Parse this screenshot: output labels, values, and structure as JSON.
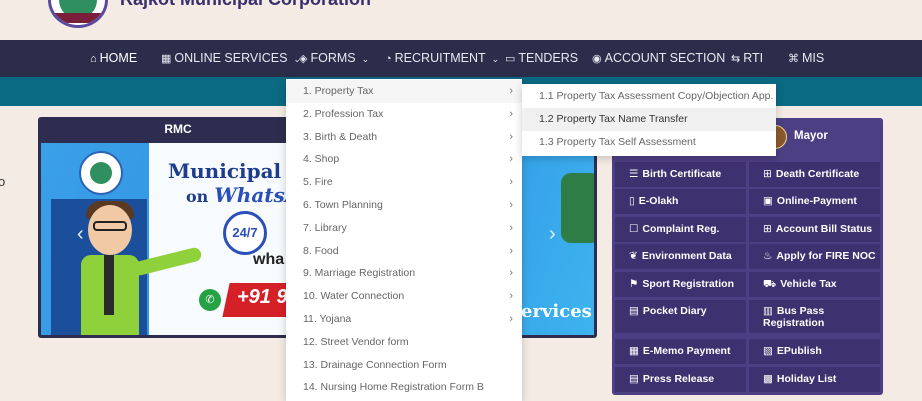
{
  "header": {
    "org_title": "Rajkot Municipal Corporation"
  },
  "nav": {
    "items": [
      {
        "label": "HOME",
        "icon": "home-icon",
        "glyph": "⌂",
        "caret": ""
      },
      {
        "label": "ONLINE SERVICES",
        "icon": "grid-icon",
        "glyph": "▦",
        "caret": "⌄"
      },
      {
        "label": "FORMS",
        "icon": "layers-icon",
        "glyph": "◈",
        "caret": "⌄"
      },
      {
        "label": "RECRUITMENT",
        "icon": "recruitment-icon",
        "glyph": "◔",
        "caret": "⌄"
      },
      {
        "label": "TENDERS",
        "icon": "calendar-icon",
        "glyph": "▭",
        "caret": ""
      },
      {
        "label": "ACCOUNT SECTION",
        "icon": "account-icon",
        "glyph": "◉",
        "caret": ""
      },
      {
        "label": "RTI",
        "icon": "rti-icon",
        "glyph": "⇆",
        "caret": ""
      },
      {
        "label": "MIS",
        "icon": "command-icon",
        "glyph": "⌘",
        "caret": ""
      }
    ]
  },
  "rmc": {
    "title": "RMC",
    "slide": {
      "headline": "Municipal Ser",
      "on": "on",
      "whatsapp": "WhatsA",
      "clock": "24/7",
      "wha": "wha",
      "phone": "+91 9",
      "services": "ervices",
      "prev": "‹",
      "next": "›"
    }
  },
  "forms_menu": {
    "items": [
      {
        "label": "1. Property Tax",
        "arrow": "›"
      },
      {
        "label": "2. Profession Tax",
        "arrow": "›"
      },
      {
        "label": "3. Birth & Death",
        "arrow": "›"
      },
      {
        "label": "4. Shop",
        "arrow": "›"
      },
      {
        "label": "5. Fire",
        "arrow": "›"
      },
      {
        "label": "6. Town Planning",
        "arrow": "›"
      },
      {
        "label": "7. Library",
        "arrow": "›"
      },
      {
        "label": "8. Food",
        "arrow": "›"
      },
      {
        "label": "9. Marriage Registration",
        "arrow": "›"
      },
      {
        "label": "10. Water Connection",
        "arrow": "›"
      },
      {
        "label": "11. Yojana",
        "arrow": "›"
      },
      {
        "label": "12. Street Vendor form",
        "arrow": ""
      },
      {
        "label": "13. Drainage Connection Form",
        "arrow": ""
      },
      {
        "label": "14. Nursing Home Registration Form B",
        "arrow": ""
      }
    ]
  },
  "property_tax_menu": {
    "items": [
      {
        "label": "1.1 Property Tax Assessment Copy/Objection App."
      },
      {
        "label": "1.2 Property Tax Name Transfer"
      },
      {
        "label": "1.3 Property Tax Self Assessment"
      }
    ]
  },
  "quick_links": {
    "mayor": "Mayor",
    "buttons": [
      {
        "label": "Birth Certificate",
        "icon": "list-icon",
        "glyph": "☰"
      },
      {
        "label": "Death Certificate",
        "icon": "grid-icon",
        "glyph": "⊞"
      },
      {
        "label": "E-Olakh",
        "icon": "card-icon",
        "glyph": "▯"
      },
      {
        "label": "Online-Payment",
        "icon": "payment-icon",
        "glyph": "▣"
      },
      {
        "label": "Complaint Reg.",
        "icon": "square-icon",
        "glyph": "☐"
      },
      {
        "label": "Account Bill Status",
        "icon": "grid-icon",
        "glyph": "⊞"
      },
      {
        "label": "Environment Data",
        "icon": "leaf-icon",
        "glyph": "❦"
      },
      {
        "label": "Apply for FIRE NOC",
        "icon": "fire-icon",
        "glyph": "♨"
      },
      {
        "label": "Sport Registration",
        "icon": "sport-icon",
        "glyph": "⚑"
      },
      {
        "label": "Vehicle Tax",
        "icon": "car-icon",
        "glyph": "⛟"
      },
      {
        "label": "Pocket Diary",
        "icon": "book-icon",
        "glyph": "▤"
      },
      {
        "label": "Bus Pass Registration",
        "icon": "bus-icon",
        "glyph": "▥"
      },
      {
        "label": "E-Memo Payment",
        "icon": "memo-icon",
        "glyph": "▦"
      },
      {
        "label": "EPublish",
        "icon": "publish-icon",
        "glyph": "▧"
      },
      {
        "label": "Press Release",
        "icon": "press-icon",
        "glyph": "▤"
      },
      {
        "label": "Holiday List",
        "icon": "calendar-icon",
        "glyph": "▩"
      }
    ]
  },
  "colors": {
    "navbar": "#2b2d4b",
    "teal_bar": "#0a6a83",
    "panel": "#4d3f84",
    "button": "#3e3170",
    "page_bg": "#f4ebe4"
  },
  "edge_text": "o"
}
